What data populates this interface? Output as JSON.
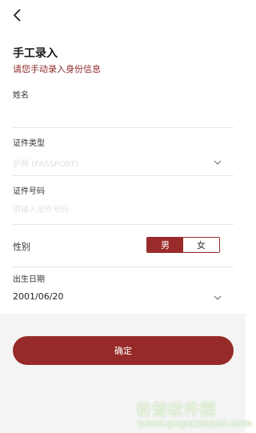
{
  "header": {
    "back_icon": "chevron-left-icon"
  },
  "page": {
    "title": "手工录入",
    "subtitle": "请您手动录入身份信息"
  },
  "form": {
    "name": {
      "label": "姓名",
      "value": "",
      "placeholder": ""
    },
    "id_type": {
      "label": "证件类型",
      "value": "护照 (PASSPORT)"
    },
    "id_number": {
      "label": "证件号码",
      "placeholder": "请输入证件号码"
    },
    "gender": {
      "label": "性别",
      "options": [
        "男",
        "女"
      ],
      "selected": "男"
    },
    "birth_date": {
      "label": "出生日期",
      "value": "2001/06/20"
    }
  },
  "actions": {
    "confirm_label": "确定"
  },
  "watermark": {
    "text_cn": "谷普软件园",
    "text_url": "www.gupuxlazal.com"
  },
  "colors": {
    "accent": "#962a28",
    "subtitle": "#8e2a2a"
  }
}
